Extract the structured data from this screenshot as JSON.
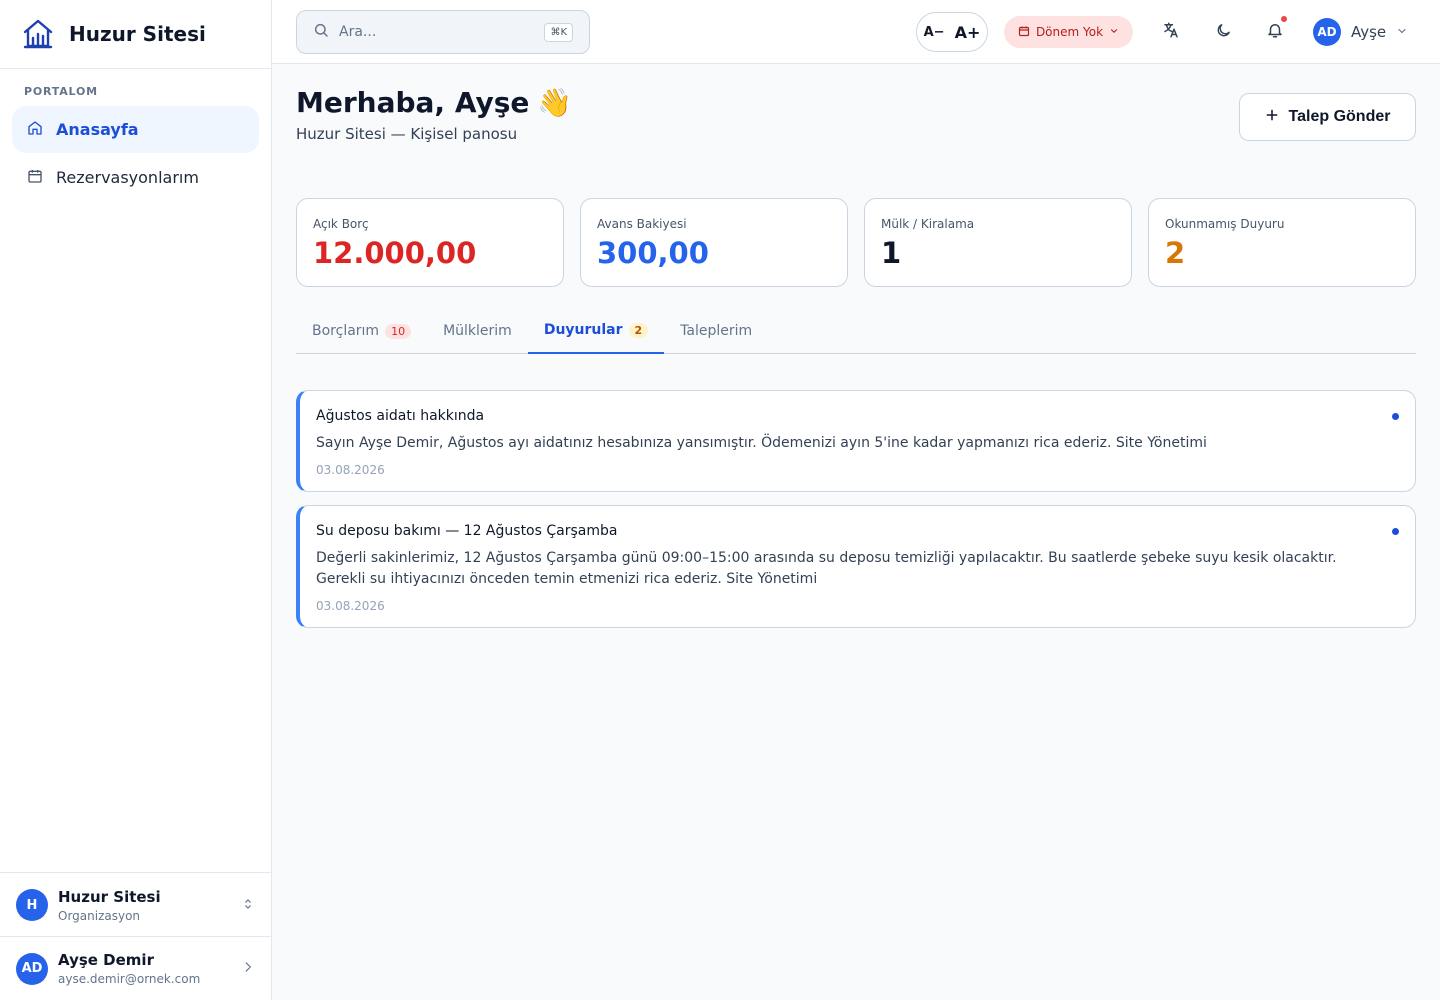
{
  "sidebar": {
    "brand": "Huzur Sitesi",
    "section": "PORTALOM",
    "items": [
      {
        "label": "Anasayfa",
        "icon": "home-icon",
        "active": true
      },
      {
        "label": "Rezervasyonlarım",
        "icon": "calendar-icon",
        "active": false
      }
    ],
    "org": {
      "initial": "H",
      "name": "Huzur Sitesi",
      "role": "Organizasyon"
    },
    "user": {
      "initials": "AD",
      "name": "Ayşe Demir",
      "email": "ayse.demir@ornek.com"
    }
  },
  "topbar": {
    "search_placeholder": "Ara...",
    "search_shortcut": "⌘K",
    "font_decrease": "A−",
    "font_increase": "A+",
    "period_label": "Dönem Yok",
    "profile_initials": "AD",
    "profile_name": "Ayşe",
    "has_unread_notifications": true
  },
  "header": {
    "greeting": "Merhaba, Ayşe",
    "emoji": "👋",
    "subtitle": "Huzur Sitesi — Kişisel panosu",
    "action_label": "Talep Gönder"
  },
  "stats": [
    {
      "label": "Açık Borç",
      "value": "12.000,00",
      "color": "#dc2626"
    },
    {
      "label": "Avans Bakiyesi",
      "value": "300,00",
      "color": "#2563eb"
    },
    {
      "label": "Mülk / Kiralama",
      "value": "1",
      "color": "#0f172a"
    },
    {
      "label": "Okunmamış Duyuru",
      "value": "2",
      "color": "#d97706"
    }
  ],
  "tabs": [
    {
      "label": "Borçlarım",
      "badge": "10"
    },
    {
      "label": "Mülklerim",
      "badge": ""
    },
    {
      "label": "Duyurular",
      "badge": "2"
    },
    {
      "label": "Taleplerim",
      "badge": ""
    }
  ],
  "active_tab": "Duyurular",
  "announcements": [
    {
      "title": "Ağustos aidatı hakkında",
      "body": "Sayın Ayşe Demir, Ağustos ayı aidatınız hesabınıza yansımıştır. Ödemenizi ayın 5'ine kadar yapmanızı rica ederiz. Site Yönetimi",
      "date": "03.08.2026",
      "unread": true
    },
    {
      "title": "Su deposu bakımı — 12 Ağustos Çarşamba",
      "body": "Değerli sakinlerimiz, 12 Ağustos Çarşamba günü 09:00–15:00 arasında su deposu temizliği yapılacaktır. Bu saatlerde şebeke suyu kesik olacaktır. Gerekli su ihtiyacınızı önceden temin etmenizi rica ederiz. Site Yönetimi",
      "date": "03.08.2026",
      "unread": true
    }
  ]
}
